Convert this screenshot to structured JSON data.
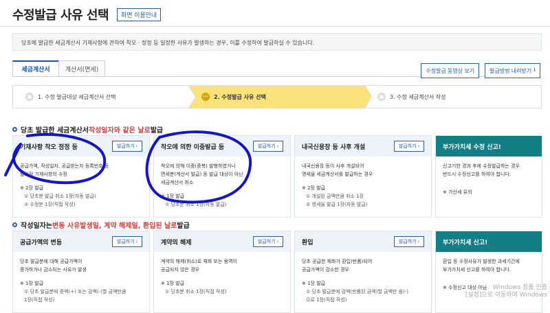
{
  "header": {
    "title": "수정발급 사유 선택",
    "guide_label": "화면 이용안내"
  },
  "notice": "당초에 발급한 세금계산서 기재사항에 관하여 착오 · 정정 등 일정한 사유가 발생하는 경우, 이를 수정하여 발급하실 수 있습니다.",
  "tabs": [
    {
      "label": "세금계산서"
    },
    {
      "label": "계산서(면세)"
    }
  ],
  "actions": {
    "video_label": "수정발급 동영상 보기",
    "download_label": "발급방법 내려받기"
  },
  "steps": [
    {
      "label": "1. 수정 발급대상 세금계산서 선택"
    },
    {
      "label": "2. 수정발급 사유 선택",
      "active": true
    },
    {
      "label": "3. 수정 세금계산서 작성"
    }
  ],
  "section1": {
    "prefix": "당초 발급한 세금계산서 ",
    "highlight": "작성일자와 같은 날로",
    "suffix": " 발급"
  },
  "section2": {
    "prefix": "작성일자는 ",
    "highlight": "변동 사유발생일, 계약 해제일, 환입된 날로",
    "suffix": " 발급"
  },
  "issue_label": "발급하기",
  "cards1": [
    {
      "title": "기재사항 착오 정정 등",
      "desc": "공급가액, 작성일자, 공급받는자 등록번호 등\n필요적 기재사항의 수정",
      "count": "※ 2장 발급",
      "items": [
        "① 당초분 발급 취소 1장(자동 발급)",
        "② 수정분 1장(직접 작성)"
      ]
    },
    {
      "title": "착오에 의한 이중발급 등",
      "desc": "착오에 의해 이중(중복) 발행하였거나\n면세분(계산서 발급) 등 발급 대상이 아닌\n세금계산서 취소",
      "count": "※ 1장 발급",
      "items": [
        "① 당초분 취소 1장(자동 발급)"
      ]
    },
    {
      "title": "내국신용장 등 사후 개설",
      "desc": "내국신용장 등이 사후 개설되어\n영세율 세금계산서를 발급하는 경우",
      "count": "※ 2장 발급",
      "items": [
        "① 개설된 금액만큼 취소 1장",
        "② 영세율 발급 1장(자동 발급)"
      ]
    }
  ],
  "cards2": [
    {
      "title": "공급가액의 변동",
      "desc": "당초 발급분에 대해 공급가액이\n증가하거나 감소되는 사유가 발생",
      "count": "※ 1장 발급",
      "items": [
        "① 당초 발급분에 증액(+) 또는 감액(-)할 금액만큼",
        "1장(직접 작성)"
      ]
    },
    {
      "title": "계약의 해제",
      "desc": "계약의 해제(취소)로 재화 또는 용역이\n공급되지 않은 경우",
      "count": "※ 1장 발급",
      "items": [
        "① 당초분 취소 1장(직접 작성)"
      ]
    },
    {
      "title": "환입",
      "desc": "당초 공급한 재화가 환입(반품)되어\n공급가액이 감소한 경우",
      "count": "※ 1장 발급",
      "items": [
        "① 당초 발급분에 감액(반품된 금액)할 금액만 음(-)",
        "으로 1장(직접 작성)"
      ]
    }
  ],
  "side1": {
    "title": "부가가치세 수정 신고!",
    "desc": "신고기한 경과 후에 수정발급하는 경우\n반드시 수정신고를 하여야 합니다.",
    "note": "※ 가산세 유의"
  },
  "side2": {
    "title": "부가가치세 신고!",
    "desc": "환입 등 수정사유가 발생한 과세기간에\n부가가치세 신고를 하여야 합니다.",
    "note": "※ 수정신고 대상 아님"
  },
  "watermark": {
    "line1": "Windows 정품 인증",
    "line2": "[설정]으로 이동하여 Windows"
  }
}
